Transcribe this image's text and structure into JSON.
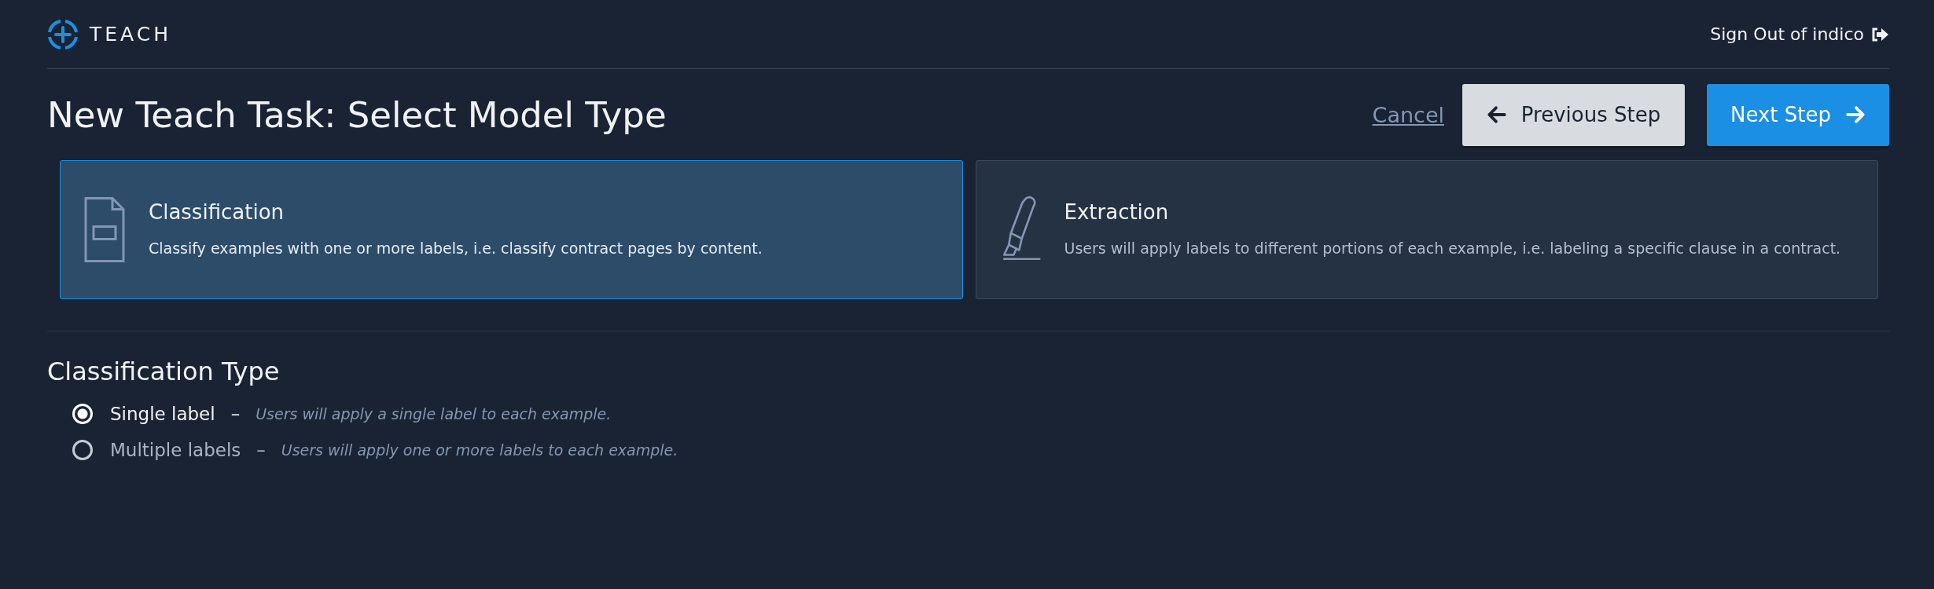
{
  "header": {
    "logo_text": "TEACH",
    "sign_out": "Sign Out of indico"
  },
  "page_title": "New Teach Task: Select Model Type",
  "actions": {
    "cancel": "Cancel",
    "previous": "Previous Step",
    "next": "Next Step"
  },
  "model_types": [
    {
      "kind": "classification",
      "title": "Classification",
      "description": "Classify examples with one or more labels, i.e. classify contract pages by content.",
      "selected": true
    },
    {
      "kind": "extraction",
      "title": "Extraction",
      "description": "Users will apply labels to different portions of each example, i.e. labeling a specific clause in a contract.",
      "selected": false
    }
  ],
  "classification_type": {
    "heading": "Classification Type",
    "options": [
      {
        "label": "Single label",
        "separator": "–",
        "description": "Users will apply a single label to each example.",
        "selected": true
      },
      {
        "label": "Multiple labels",
        "separator": "–",
        "description": "Users will apply one or more labels to each example.",
        "selected": false
      }
    ]
  }
}
